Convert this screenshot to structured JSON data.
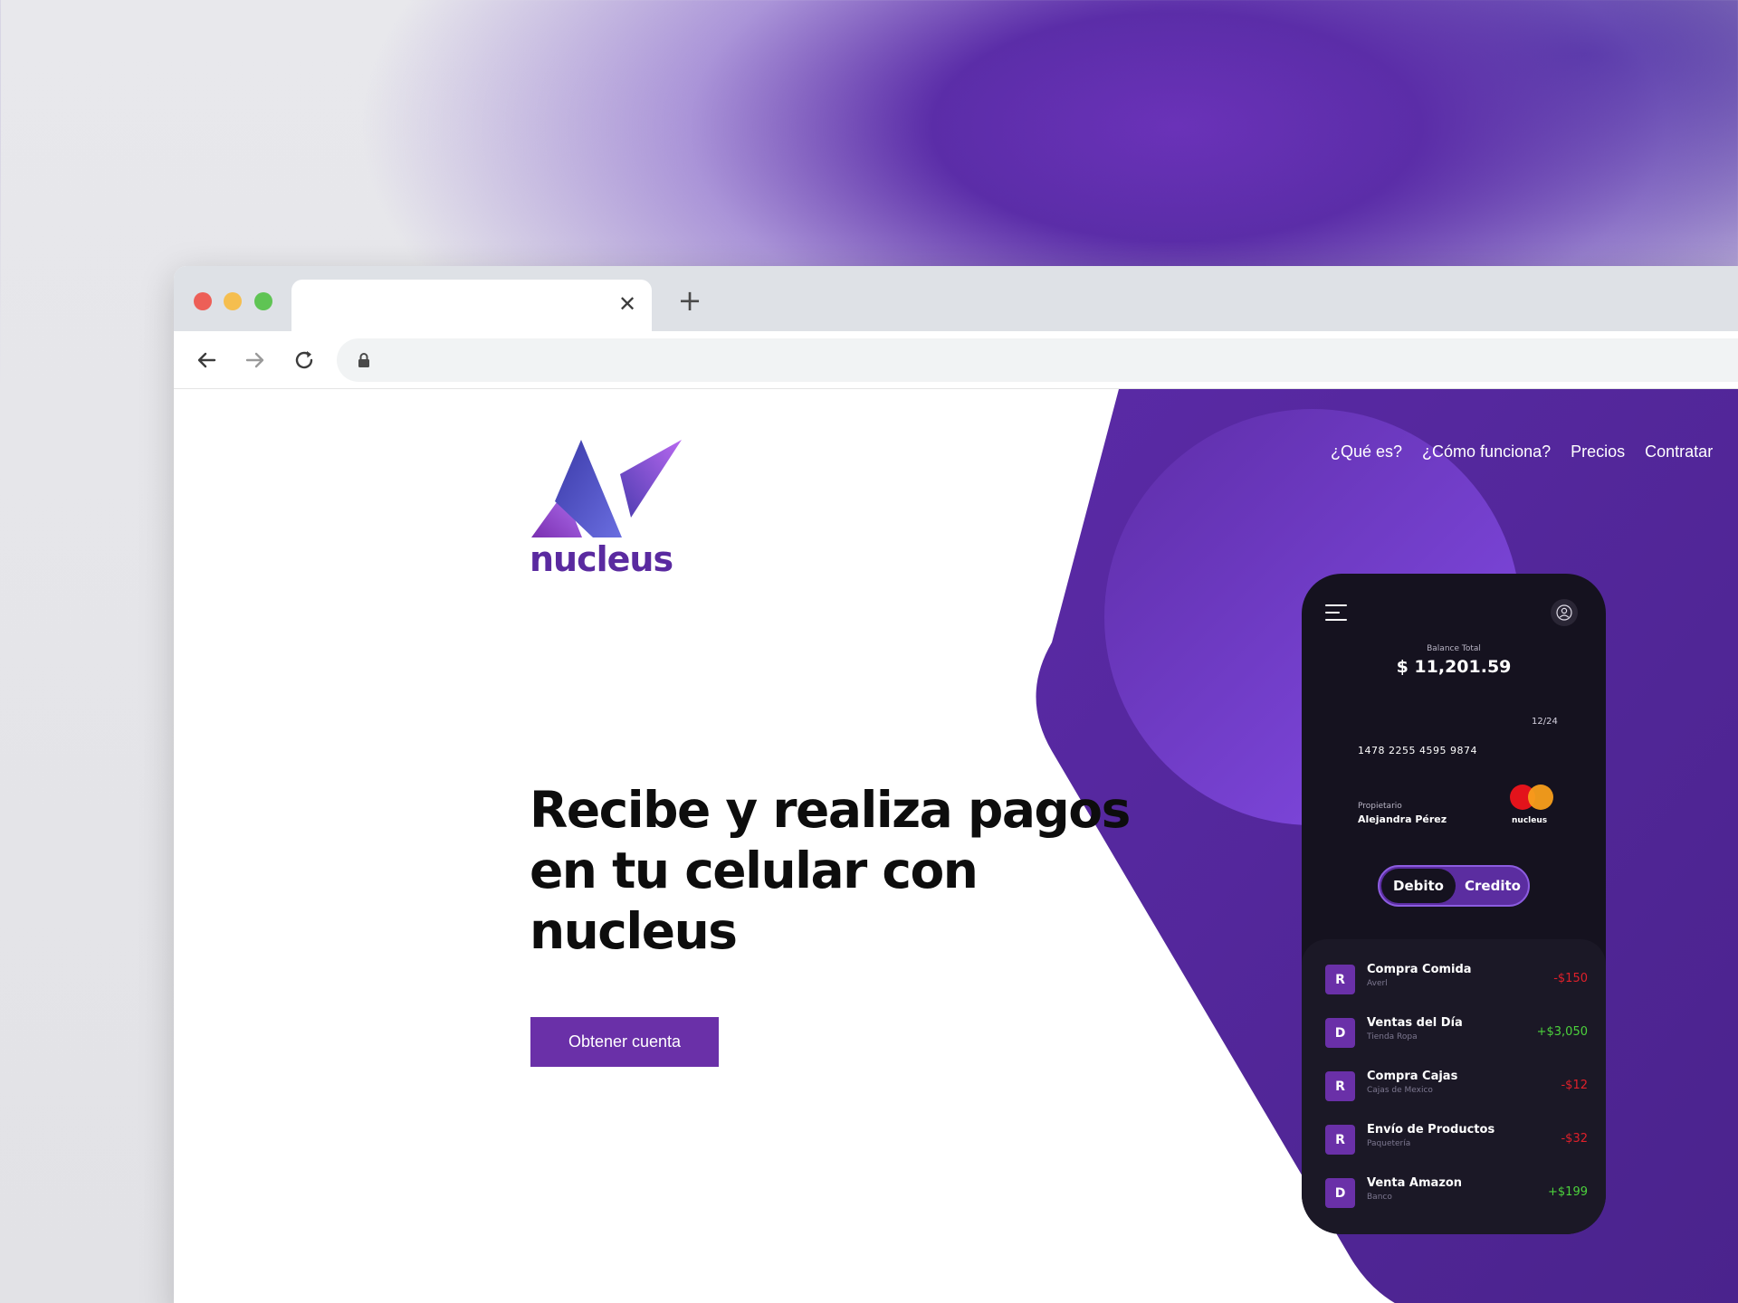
{
  "browser": {
    "tab_close_glyph": "✕",
    "new_tab_glyph": "+"
  },
  "site": {
    "logo_text": "nucleus",
    "nav": [
      "¿Qué es?",
      "¿Cómo funciona?",
      "Precios",
      "Contratar"
    ],
    "hero": {
      "line1": "Recibe y realiza pagos",
      "line2": "en tu celular con",
      "line3": "nucleus",
      "cta": "Obtener cuenta"
    }
  },
  "phone": {
    "balance_label": "Balance Total",
    "balance": "$ 11,201.59",
    "card": {
      "expiry": "12/24",
      "number": "1478 2255 4595 9874",
      "owner_label": "Propietario",
      "owner": "Alejandra Pérez",
      "brand": "nucleus"
    },
    "toggle": {
      "active": "Debito",
      "inactive": "Credito"
    },
    "transactions": [
      {
        "badge": "R",
        "title": "Compra Comida",
        "sub": "Averl",
        "amount": "-$150",
        "type": "debit"
      },
      {
        "badge": "D",
        "title": "Ventas del Día",
        "sub": "Tienda Ropa",
        "amount": "+$3,050",
        "type": "credit"
      },
      {
        "badge": "R",
        "title": "Compra Cajas",
        "sub": "Cajas de Mexico",
        "amount": "-$12",
        "type": "debit"
      },
      {
        "badge": "R",
        "title": "Envío de Productos",
        "sub": "Paquetería",
        "amount": "-$32",
        "type": "debit"
      },
      {
        "badge": "D",
        "title": "Venta Amazon",
        "sub": "Banco",
        "amount": "+$199",
        "type": "credit"
      }
    ]
  },
  "colors": {
    "brand_purple": "#6a30a8",
    "phone_bg": "#15121f",
    "debit": "#e0202a",
    "credit": "#4cd23c"
  }
}
